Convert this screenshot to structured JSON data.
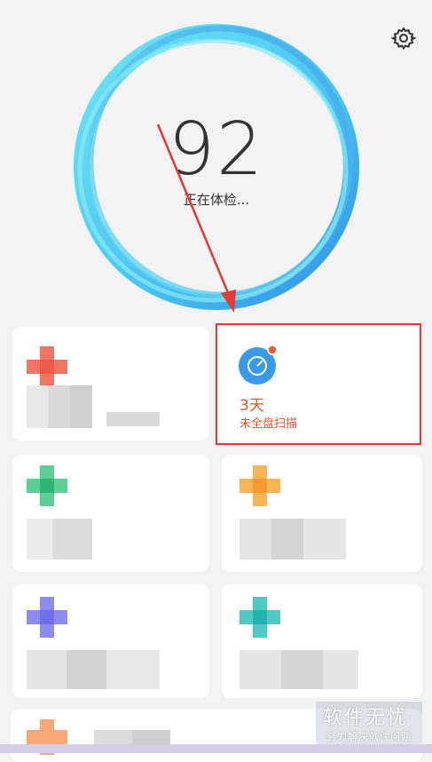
{
  "header": {
    "settings_icon": "gear-icon"
  },
  "health": {
    "score": "92",
    "status": "正在体检..."
  },
  "scan_card": {
    "icon": "timer-icon",
    "days": "3天",
    "label": "未全盘扫描"
  },
  "watermark": {
    "title": "软件无忧",
    "subtitle": "努力解决软件问题"
  },
  "colors": {
    "accent_red": "#e8522f",
    "ring_blue": "#3fa4ee",
    "ring_cyan": "#5fe0f2",
    "highlight_red": "#e53935"
  }
}
